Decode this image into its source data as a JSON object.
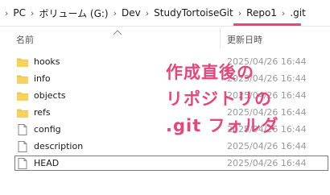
{
  "breadcrumb": {
    "items": [
      "PC",
      "ボリューム (G:)",
      "Dev",
      "StudyTortoiseGit",
      "Repo1",
      ".git"
    ]
  },
  "columns": {
    "name": "名前",
    "date": "更新日時"
  },
  "files": [
    {
      "name": "hooks",
      "type": "folder",
      "date": "2025/04/26 16:44"
    },
    {
      "name": "info",
      "type": "folder",
      "date": "2025/04/26 16:44"
    },
    {
      "name": "objects",
      "type": "folder",
      "date": "2025/04/26 16:44"
    },
    {
      "name": "refs",
      "type": "folder",
      "date": "2025/04/26 16:44"
    },
    {
      "name": "config",
      "type": "file",
      "date": "2025/04/26 16:44"
    },
    {
      "name": "description",
      "type": "file",
      "date": "2025/04/26 16:44"
    },
    {
      "name": "HEAD",
      "type": "file",
      "date": "2025/04/26 16:44"
    }
  ],
  "annotation": {
    "lines": [
      "作成直後の",
      "リポジトリの",
      ".git フォルダ"
    ],
    "color": "#e8457a"
  },
  "colors": {
    "highlight_underline": "#e8457a",
    "folder": "#f6c542"
  }
}
